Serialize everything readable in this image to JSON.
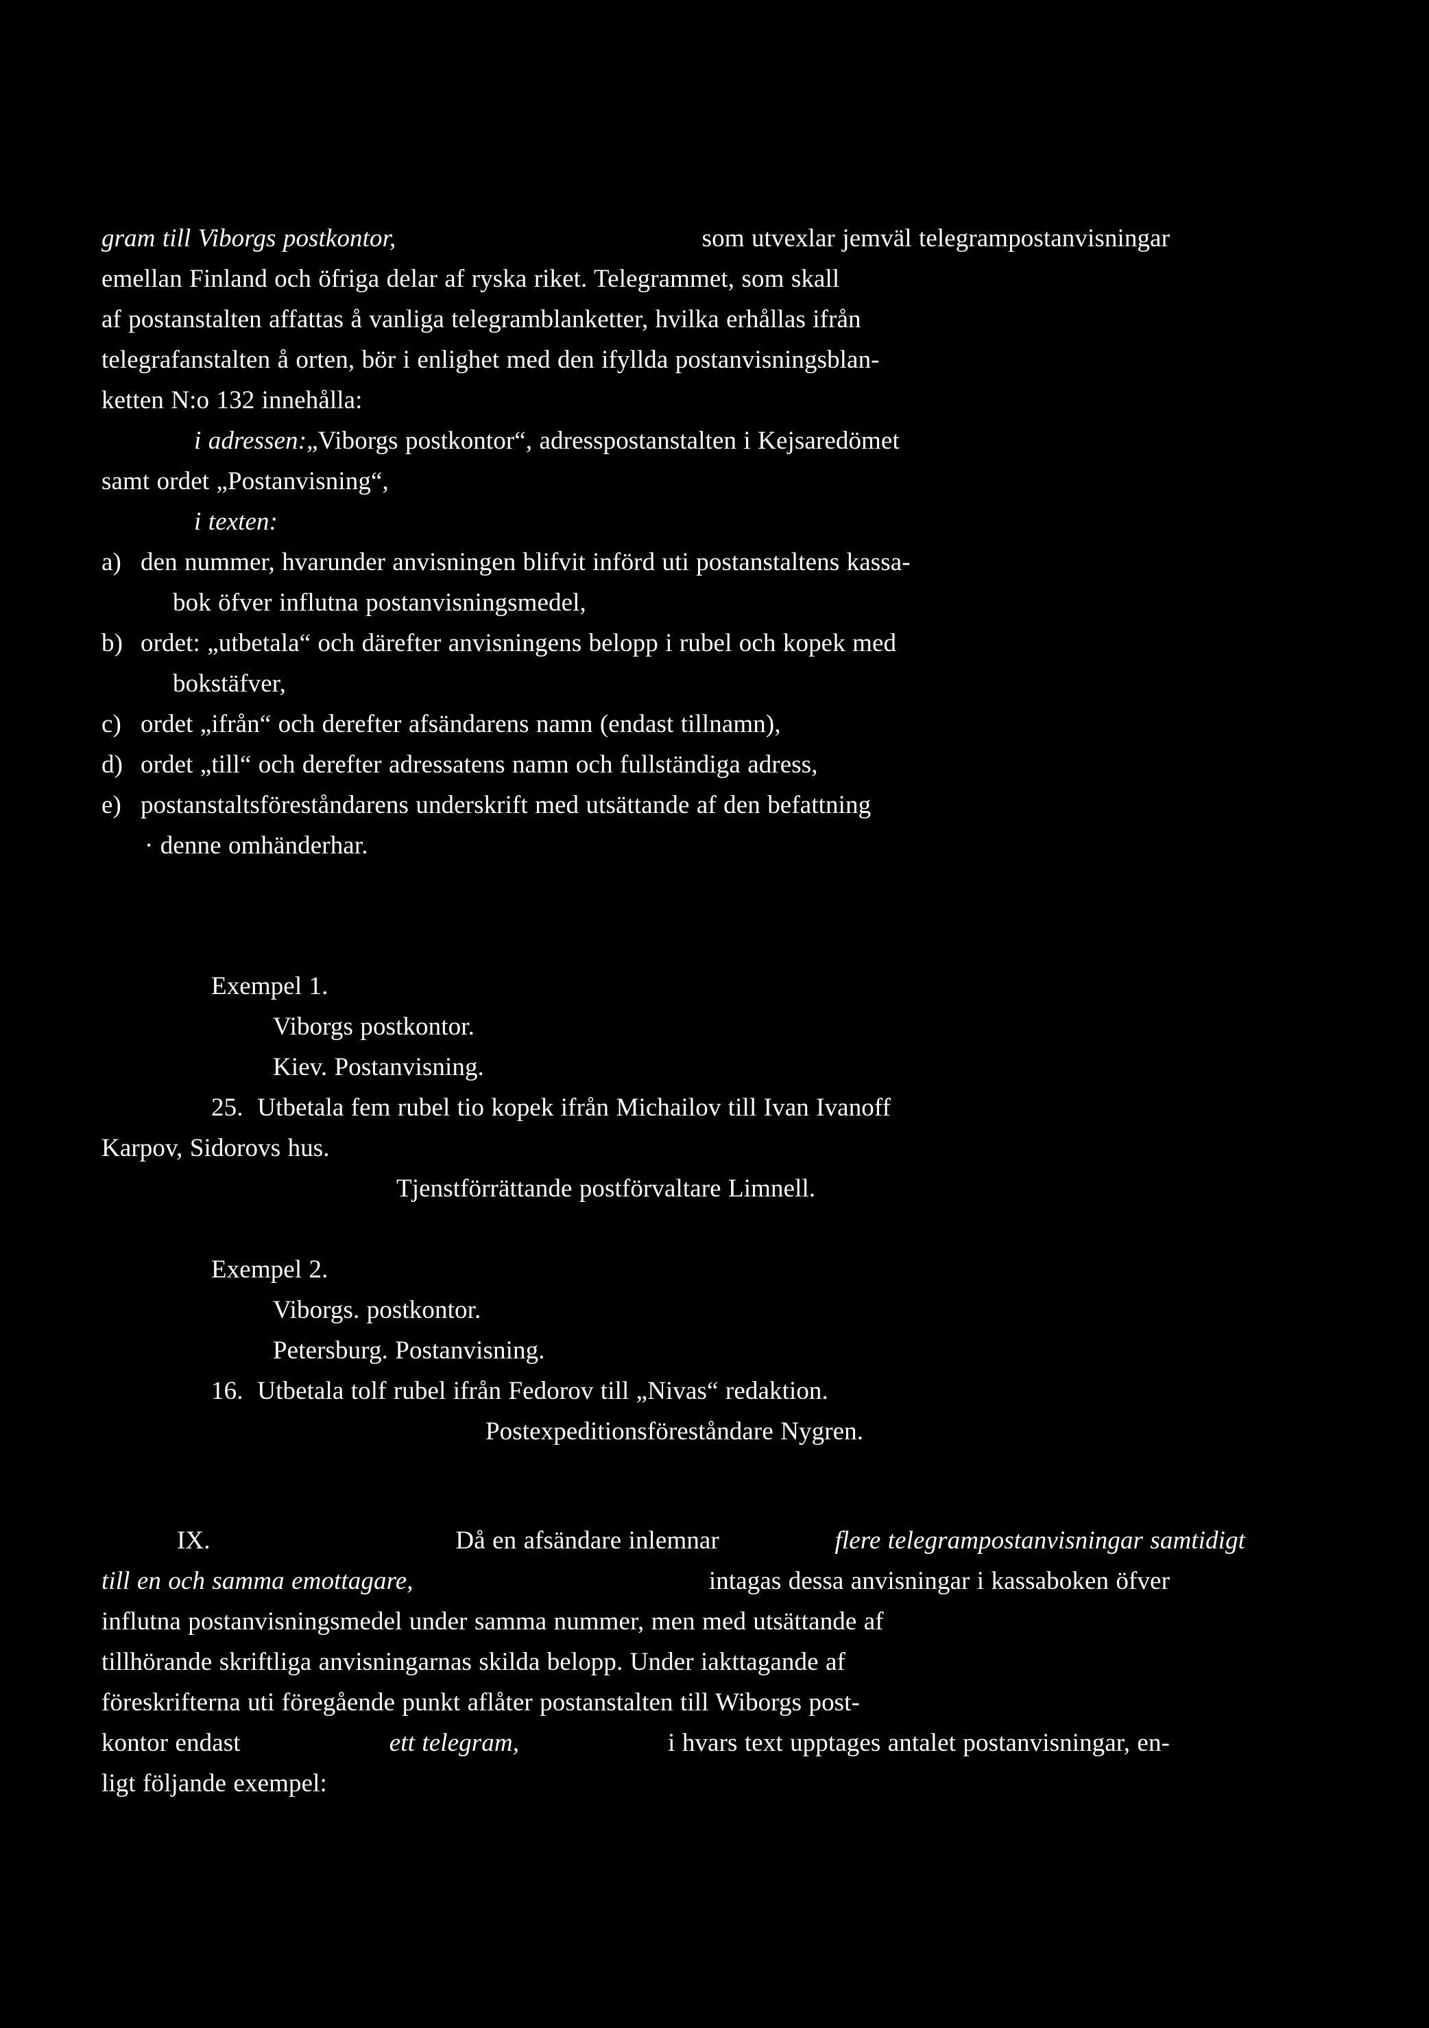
{
  "document": {
    "language": "Swedish",
    "background_color": "#000000",
    "text_color": "#ffffff",
    "body": {
      "opening_paragraph": {
        "line1_italic": "gram till Viborgs postkontor,",
        "line1_rest": "som  utvexlar  jemväl  telegrampostanvisningar",
        "line2": "emellan  Finland  och  öfriga  delar  af  ryska  riket.   Telegrammet,  som  skall",
        "line3": "af  postanstalten  affattas  å  vanliga  telegramblanketter,  hvilka  erhållas  ifrån",
        "line4": "telegrafanstalten  å  orten,  bör  i  enlighet  med  den  ifyllda  postanvisningsblan-",
        "line5": "ketten N:o 132 innehålla:"
      },
      "address_clause": {
        "label_italic": "i adressen:",
        "text": "„Viborgs postkontor“, adresspostanstalten i Kejsaredömet",
        "continuation": "samt ordet „Postanvisning“,"
      },
      "text_clause_label_italic": "i texten:",
      "items": [
        {
          "marker": "a)",
          "line1": "den  nummer,  hvarunder  anvisningen  blifvit  införd  uti  postanstaltens  kassa-",
          "line2": "bok  öfver  influtna  postanvisningsmedel,"
        },
        {
          "marker": "b)",
          "line1": "ordet:  „utbetala“  och  därefter  anvisningens  belopp  i  rubel  och  kopek  med",
          "line2": "bokstäfver,"
        },
        {
          "marker": "c)",
          "line1": "ordet  „ifrån“  och  derefter  afsändarens  namn  (endast  tillnamn),",
          "line2": ""
        },
        {
          "marker": "d)",
          "line1": "ordet  „till“  och  derefter  adressatens  namn  och  fullständiga  adress,",
          "line2": ""
        },
        {
          "marker": "e)",
          "line1": "postanstaltsföreståndarens  underskrift  med  utsättande  af  den  befattning",
          "line2": "· denne  omhänderhar."
        }
      ],
      "example1": {
        "heading": "Exempel 1.",
        "office": "Viborgs  postkontor.",
        "origin_line": "Kiev.   Postanvisning.",
        "number": "25.",
        "body_line1": "Utbetala  fem   rubel   tio   kopek  ifrån  Michailov  till  Ivan  Ivanoff",
        "body_line2": "Karpov,  Sidorovs  hus.",
        "signature": "Tjenstförrättande  postförvaltare  Limnell."
      },
      "example2": {
        "heading": "Exempel 2.",
        "office": "Viborgs. postkontor.",
        "origin_line": "Petersburg.   Postanvisning.",
        "number": "16.",
        "body_line1": "Utbetala  tolf  rubel  ifrån  Fedorov  till  „Nivas“  redaktion.",
        "signature": "Postexpeditionsföreståndare  Nygren."
      },
      "section_ix": {
        "numeral": "IX.",
        "line1_plain": "Då  en  afsändare  inlemnar ",
        "line1_italic": "flere  telegrampostanvisningar  samtidigt",
        "line2_italic": "till  en  och  samma  emottagare,",
        "line2_plain": " intagas  dessa  anvisningar  i  kassaboken  öfver",
        "line3": "influtna postanvisningsmedel under samma nummer,  men med utsättande af",
        "line4": "tillhörande  skriftliga  anvisningarnas  skilda  belopp.   Under  iakttagande  af",
        "line5": "föreskrifterna  uti  föregående  punkt  aflåter  postanstalten  till  Wiborgs  post-",
        "line6_a": "kontor  endast ",
        "line6_italic": "ett  telegram,",
        "line6_b": " i hvars  text  upptages  antalet  postanvisningar, en-",
        "line7": "ligt  följande  exempel:"
      }
    }
  }
}
